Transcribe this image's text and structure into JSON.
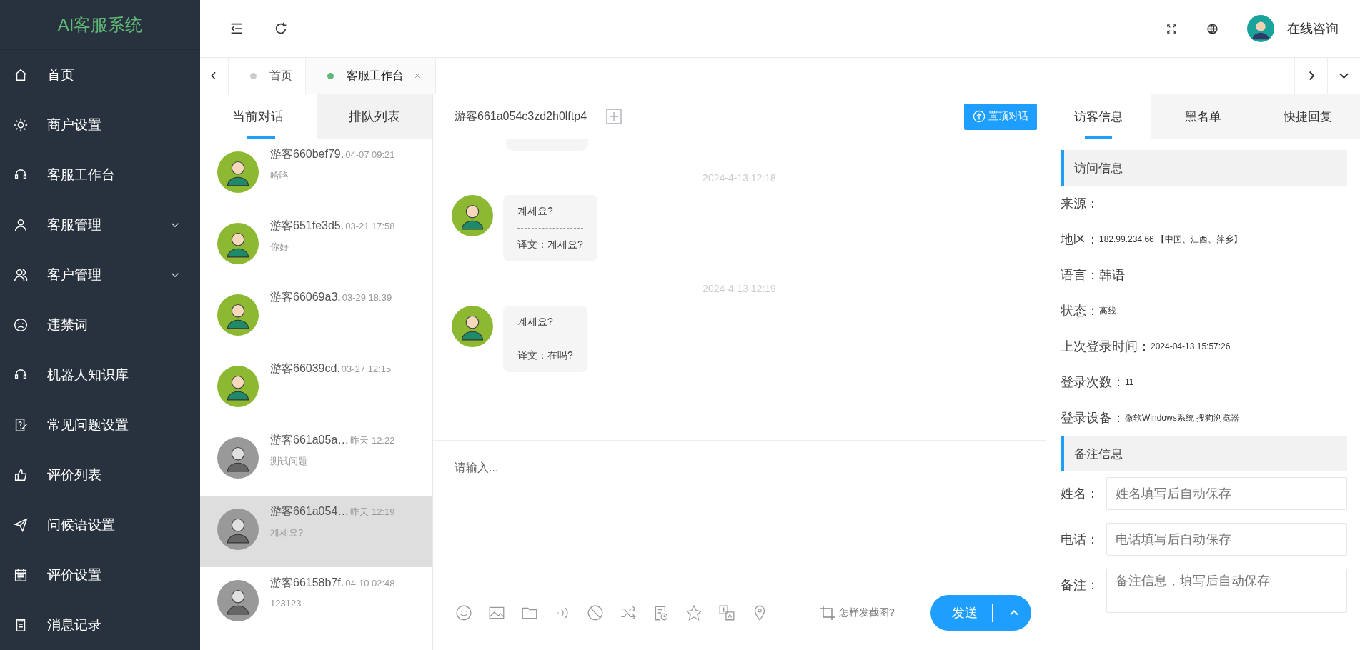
{
  "sidebar": {
    "logo": "AI客服系统",
    "items": [
      {
        "label": "首页",
        "submenu": false
      },
      {
        "label": "商户设置",
        "submenu": false
      },
      {
        "label": "客服工作台",
        "submenu": false
      },
      {
        "label": "客服管理",
        "submenu": true
      },
      {
        "label": "客户管理",
        "submenu": true
      },
      {
        "label": "违禁词",
        "submenu": false
      },
      {
        "label": "机器人知识库",
        "submenu": false
      },
      {
        "label": "常见问题设置",
        "submenu": false
      },
      {
        "label": "评价列表",
        "submenu": false
      },
      {
        "label": "问候语设置",
        "submenu": false
      },
      {
        "label": "评价设置",
        "submenu": false
      },
      {
        "label": "消息记录",
        "submenu": false
      }
    ]
  },
  "header": {
    "user_name": "在线咨询"
  },
  "page_tabs": [
    {
      "label": "首页",
      "selected": false,
      "closable": false
    },
    {
      "label": "客服工作台",
      "selected": true,
      "closable": true
    }
  ],
  "conversation_tabs": [
    {
      "label": "当前对话",
      "selected": true
    },
    {
      "label": "排队列表",
      "selected": false
    }
  ],
  "conversations": [
    {
      "name": "游客660bef79.",
      "time": "04-07 09:21",
      "preview": "哈咯",
      "online": true,
      "selected": false
    },
    {
      "name": "游客651fe3d5.",
      "time": "03-21 17:58",
      "preview": "你好",
      "online": true,
      "selected": false
    },
    {
      "name": "游客66069a3.",
      "time": "03-29 18:39",
      "online": true,
      "selected": false
    },
    {
      "name": "游客66039cd.",
      "time": "03-27 12:15",
      "online": true,
      "selected": false
    },
    {
      "name": "游客661a05a…",
      "time": "昨天 12:22",
      "preview": "测试问题",
      "online": false,
      "selected": false
    },
    {
      "name": "游客661a054…",
      "time": "昨天 12:19",
      "preview": "계세요?",
      "online": false,
      "selected": true
    },
    {
      "name": "游客66158b7f.",
      "time": "04-10 02:48",
      "preview": "123123",
      "online": false,
      "selected": false
    }
  ],
  "chat": {
    "title": "游客661a054c3zd2h0lftp4",
    "pin_button": "置顶对话",
    "messages": [
      {
        "time": "2024-4-13 12:18",
        "text": "계세요?",
        "translation": "译文：계세요?"
      },
      {
        "time": "2024-4-13 12:19",
        "text": "계세요?",
        "translation": "译文：在吗?"
      }
    ],
    "input": {
      "placeholder": "请输入..."
    },
    "screenshot_help": "怎样发截图?",
    "send_button": "发送"
  },
  "visitor_tabs": [
    {
      "label": "访客信息",
      "selected": true
    },
    {
      "label": "黑名单",
      "selected": false
    },
    {
      "label": "快捷回复",
      "selected": false
    }
  ],
  "visit_info": {
    "title": "访问信息",
    "rows": [
      {
        "label": "来源："
      },
      {
        "label": "地区：",
        "value": "182.99.234.66 【中国、江西、萍乡】",
        "large": false
      },
      {
        "label": "语言：",
        "value": "韩语",
        "large": true
      },
      {
        "label": "状态：",
        "value": "离线",
        "large": false
      },
      {
        "label": "上次登录时间：",
        "value": "2024-04-13 15:57:26",
        "large": false
      },
      {
        "label": "登录次数：",
        "value": "11",
        "large": false
      },
      {
        "label": "登录设备：",
        "value": "微软Windows系统 搜狗浏览器",
        "large": false
      }
    ]
  },
  "notes": {
    "title": "备注信息",
    "fields": [
      {
        "label": "姓名：",
        "placeholder": "姓名填写后自动保存",
        "kind": "input"
      },
      {
        "label": "电话：",
        "placeholder": "电话填写后自动保存",
        "kind": "input"
      },
      {
        "label": "备注：",
        "placeholder": "备注信息，填写后自动保存",
        "kind": "textarea"
      }
    ]
  }
}
